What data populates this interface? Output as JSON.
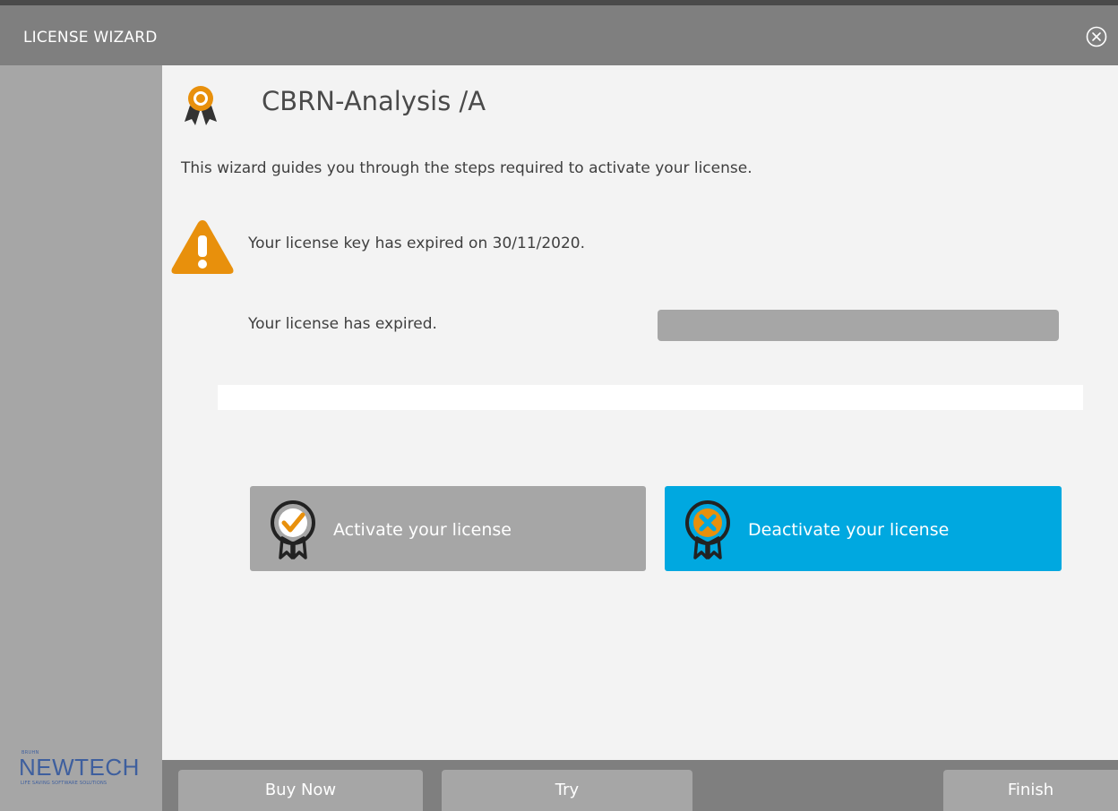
{
  "window": {
    "title": "LICENSE WIZARD",
    "close_icon": "close-circle-icon"
  },
  "brand": {
    "name": "NEWTECH",
    "tagline": "LIFE SAVING SOFTWARE SOLUTIONS",
    "tagline_top": "BRUHN"
  },
  "header": {
    "icon": "award-ribbon-icon",
    "product": "CBRN-Analysis /A"
  },
  "intro_text": "This wizard guides you through the steps required to activate your license.",
  "warning": {
    "icon": "warning-triangle-icon",
    "message": "Your license key has expired on 30/11/2020."
  },
  "status": {
    "text": "Your license has expired.",
    "progress": 0
  },
  "actions": {
    "activate": {
      "label": "Activate your license",
      "icon": "award-check-icon"
    },
    "deactivate": {
      "label": "Deactivate your license",
      "icon": "award-x-icon"
    }
  },
  "footer": {
    "buy_now": "Buy Now",
    "try": "Try",
    "finish": "Finish"
  },
  "colors": {
    "titlebar": "#7f7f7f",
    "sidebar": "#a6a6a6",
    "accent_blue": "#00a8e0",
    "accent_orange": "#e8900c"
  }
}
